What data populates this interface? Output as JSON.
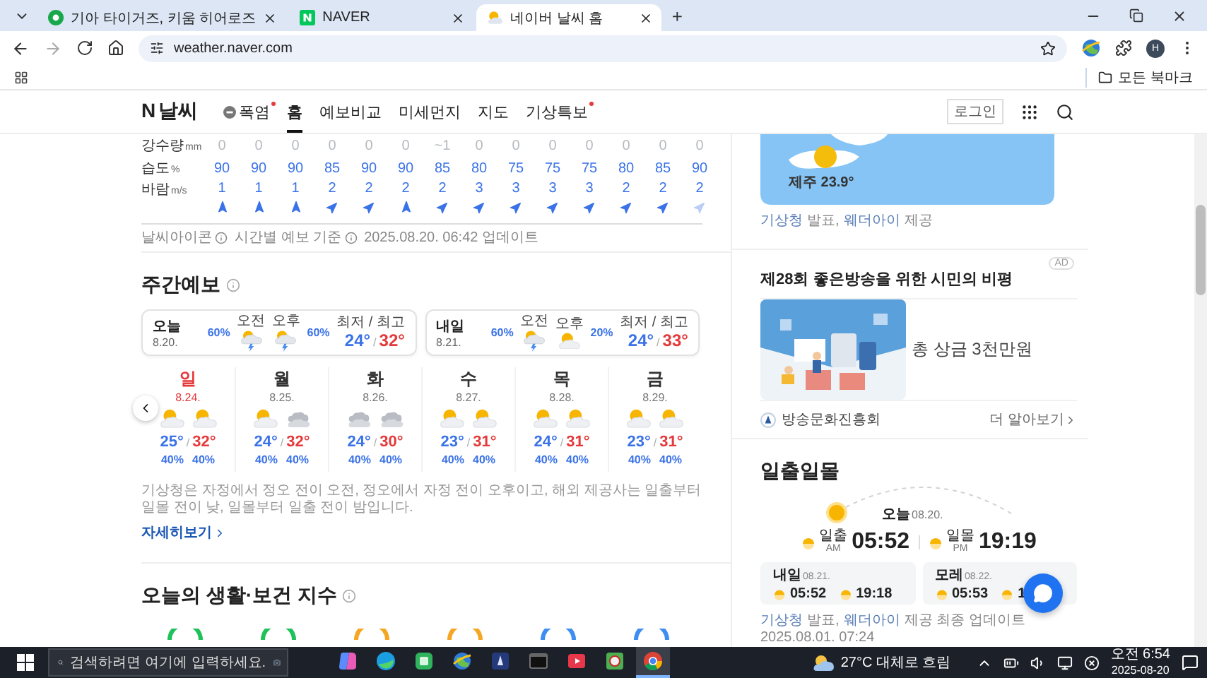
{
  "browser": {
    "tabs": [
      {
        "title": "기아 타이거즈, 키움 히어로즈",
        "selected": false
      },
      {
        "title": "NAVER",
        "selected": false
      },
      {
        "title": "네이버 날씨 홈",
        "selected": true
      }
    ],
    "new_tab": "+",
    "url": "weather.naver.com",
    "profile": "H",
    "bookmarks_folder": "모든 북마크"
  },
  "site": {
    "logo_mark": "N",
    "logo_text": "날씨",
    "nav": [
      {
        "label": "폭염",
        "icon": true,
        "badge": true,
        "selected": false
      },
      {
        "label": "홈",
        "icon": false,
        "badge": false,
        "selected": true
      },
      {
        "label": "예보비교",
        "icon": false,
        "badge": false,
        "selected": false
      },
      {
        "label": "미세먼지",
        "icon": false,
        "badge": false,
        "selected": false
      },
      {
        "label": "지도",
        "icon": false,
        "badge": false,
        "selected": false
      },
      {
        "label": "기상특보",
        "icon": false,
        "badge": true,
        "selected": false
      }
    ],
    "login": "로그인"
  },
  "hourly": {
    "rows": [
      {
        "label": "강수량",
        "unit": "mm",
        "kind": "precip",
        "values": [
          "0",
          "0",
          "0",
          "0",
          "0",
          "0",
          "~1",
          "0",
          "0",
          "0",
          "0",
          "0",
          "0",
          "0"
        ]
      },
      {
        "label": "습도",
        "unit": "%",
        "kind": "humidity",
        "values": [
          "90",
          "90",
          "90",
          "85",
          "90",
          "90",
          "85",
          "80",
          "75",
          "75",
          "75",
          "80",
          "85",
          "90"
        ]
      }
    ],
    "wind": {
      "label": "바람",
      "unit": "m/s",
      "values": [
        {
          "value": "1",
          "kind": "north"
        },
        {
          "value": "1",
          "kind": "north"
        },
        {
          "value": "1",
          "kind": "north"
        },
        {
          "value": "2",
          "kind": "northeast"
        },
        {
          "value": "2",
          "kind": "northeast"
        },
        {
          "value": "2",
          "kind": "north"
        },
        {
          "value": "2",
          "kind": "northeast"
        },
        {
          "value": "3",
          "kind": "northeast"
        },
        {
          "value": "3",
          "kind": "northeast"
        },
        {
          "value": "3",
          "kind": "northeast"
        },
        {
          "value": "3",
          "kind": "northeast"
        },
        {
          "value": "2",
          "kind": "northeast"
        },
        {
          "value": "2",
          "kind": "northeast"
        },
        {
          "value": "2",
          "kind": "northeast"
        }
      ]
    },
    "info_items": [
      "날씨아이콘",
      "시간별 예보 기준"
    ],
    "updated": "2025.08.20. 06:42 업데이트"
  },
  "weekly": {
    "title": "주간예보",
    "cards": [
      {
        "day": "오늘",
        "date": "8.20.",
        "am": {
          "label": "오전",
          "kind": "storm",
          "rain": "60%"
        },
        "pm": {
          "label": "오후",
          "kind": "storm",
          "rain": "60%"
        },
        "range_label": "최저 / 최고",
        "low": "24°",
        "sep": "/",
        "high": "32°"
      },
      {
        "day": "내일",
        "date": "8.21.",
        "am": {
          "label": "오전",
          "kind": "storm",
          "rain": "60%"
        },
        "pm": {
          "label": "오후",
          "kind": "partly",
          "rain": "20%"
        },
        "range_label": "최저 / 최고",
        "low": "24°",
        "sep": "/",
        "high": "33°"
      }
    ],
    "days": [
      {
        "day": "일",
        "date": "8.24.",
        "holiday": true,
        "am": {
          "kind": "partly",
          "rain": "40%"
        },
        "pm": {
          "kind": "partly",
          "rain": "40%"
        },
        "low": "25°",
        "sep": "/",
        "high": "32°"
      },
      {
        "day": "월",
        "date": "8.25.",
        "holiday": false,
        "am": {
          "kind": "partly",
          "rain": "40%"
        },
        "pm": {
          "kind": "cloudy",
          "rain": "40%"
        },
        "low": "24°",
        "sep": "/",
        "high": "32°"
      },
      {
        "day": "화",
        "date": "8.26.",
        "holiday": false,
        "am": {
          "kind": "cloudy",
          "rain": "40%"
        },
        "pm": {
          "kind": "cloudy",
          "rain": "40%"
        },
        "low": "24°",
        "sep": "/",
        "high": "30°"
      },
      {
        "day": "수",
        "date": "8.27.",
        "holiday": false,
        "am": {
          "kind": "partly",
          "rain": "40%"
        },
        "pm": {
          "kind": "partly",
          "rain": "40%"
        },
        "low": "23°",
        "sep": "/",
        "high": "31°"
      },
      {
        "day": "목",
        "date": "8.28.",
        "holiday": false,
        "am": {
          "kind": "partly",
          "rain": "40%"
        },
        "pm": {
          "kind": "partly",
          "rain": "40%"
        },
        "low": "24°",
        "sep": "/",
        "high": "31°"
      },
      {
        "day": "금",
        "date": "8.29.",
        "holiday": false,
        "am": {
          "kind": "partly",
          "rain": "40%"
        },
        "pm": {
          "kind": "partly",
          "rain": "40%"
        },
        "low": "23°",
        "sep": "/",
        "high": "31°"
      }
    ],
    "note": "기상청은 자정에서 정오 전이 오전, 정오에서 자정 전이 오후이고, 해외 제공사는 일출부터 일몰 전이 낮, 일몰부터 일출 전이 밤입니다.",
    "more": "자세히보기"
  },
  "life": {
    "title": "오늘의 생활·보건 지수",
    "gauges": [
      {
        "color": "#1fc15a"
      },
      {
        "color": "#1fc15a"
      },
      {
        "color": "#f5a623"
      },
      {
        "color": "#f5a623"
      },
      {
        "color": "#3d8ef0"
      },
      {
        "color": "#3d8ef0"
      }
    ]
  },
  "map": {
    "label": "제주 23.9°",
    "source": [
      {
        "text": "기상청",
        "link": true
      },
      {
        "text": "발표,",
        "link": false
      },
      {
        "text": "웨더아이",
        "link": true
      },
      {
        "text": "제공",
        "link": false
      }
    ]
  },
  "ad": {
    "badge": "AD",
    "title": "제28회 좋은방송을 위한 시민의 비평",
    "prize": "총 상금 3천만원",
    "sponsor": "방송문화진흥회",
    "more": "더 알아보기"
  },
  "sun": {
    "title": "일출일몰",
    "today": "오늘",
    "today_date": "08.20.",
    "rise_label": "일출",
    "rise_ampm": "AM",
    "rise": "05:52",
    "set_label": "일몰",
    "set_ampm": "PM",
    "set": "19:19",
    "days": [
      {
        "label": "내일",
        "date": "08.21.",
        "rise": "05:52",
        "set": "19:18"
      },
      {
        "label": "모레",
        "date": "08.22.",
        "rise": "05:53",
        "set": "1"
      }
    ],
    "source": [
      {
        "text": "기상청",
        "link": true
      },
      {
        "text": "발표,",
        "link": false
      },
      {
        "text": "웨더아이",
        "link": true
      },
      {
        "text": "제공 최종 업데이트 2025.08.01. 07:24",
        "link": false
      }
    ]
  },
  "taskbar": {
    "search": "검색하려면 여기에 입력하세요.",
    "apps": [
      {
        "kind": "copilot",
        "selected": false
      },
      {
        "kind": "edge",
        "selected": false
      },
      {
        "kind": "green",
        "selected": false
      },
      {
        "kind": "globe",
        "selected": false
      },
      {
        "kind": "dark",
        "selected": false
      },
      {
        "kind": "terminal",
        "selected": false
      },
      {
        "kind": "red",
        "selected": false
      },
      {
        "kind": "ring",
        "selected": false
      },
      {
        "kind": "chrome",
        "selected": true
      }
    ],
    "weather": "27°C 대체로 흐림",
    "time": "오전 6:54",
    "date": "2025-08-20"
  }
}
